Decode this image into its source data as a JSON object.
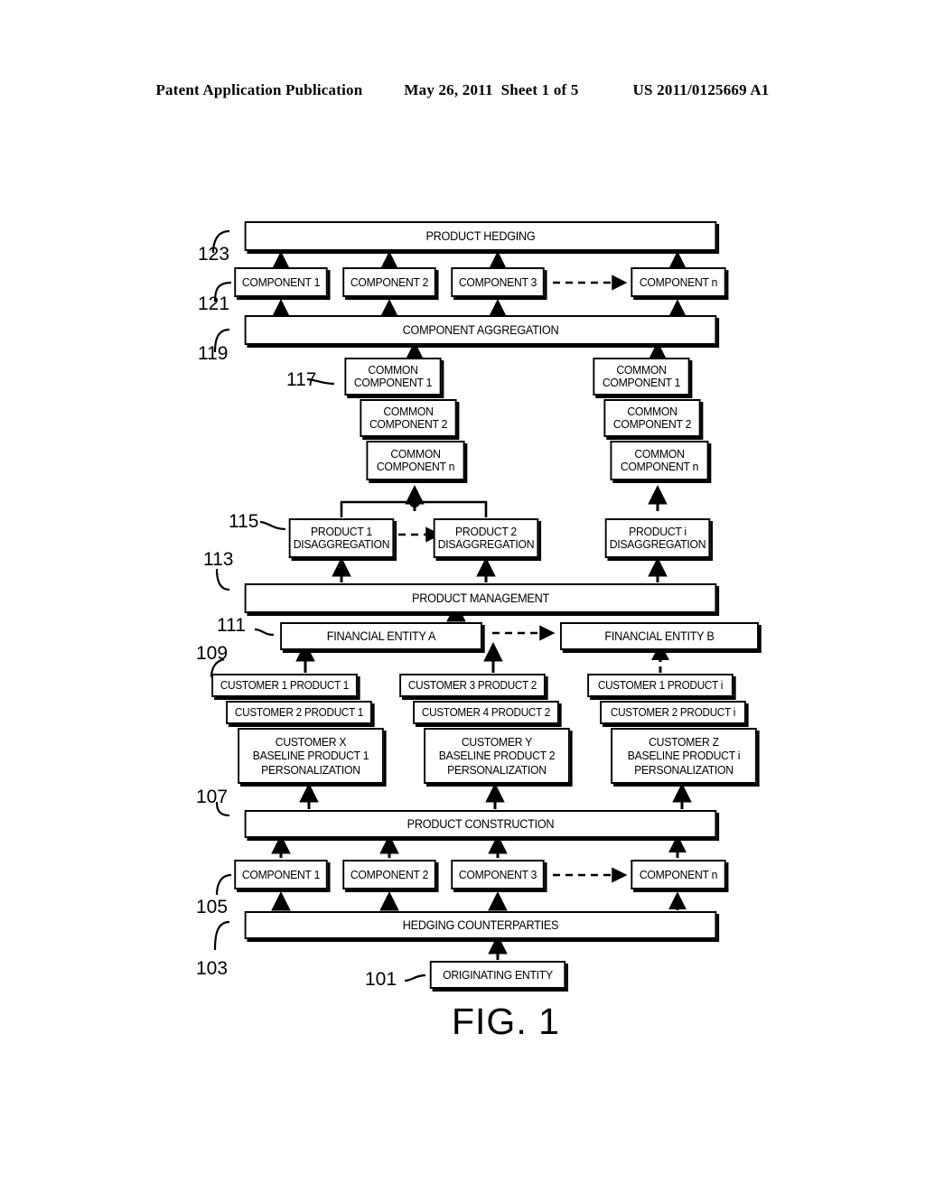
{
  "header": {
    "left": "Patent Application Publication",
    "date": "May 26, 2011",
    "sheet": "Sheet 1 of 5",
    "pubnum": "US 2011/0125669 A1"
  },
  "figure": {
    "label": "FIG. 1",
    "boxes": {
      "product_hedging": "PRODUCT HEDGING",
      "component_aggregation": "COMPONENT AGGREGATION",
      "product_management": "PRODUCT MANAGEMENT",
      "product_construction": "PRODUCT CONSTRUCTION",
      "hedging_counterparties": "HEDGING COUNTERPARTIES",
      "originating_entity": "ORIGINATING ENTITY",
      "financial_entity_a": "FINANCIAL ENTITY A",
      "financial_entity_b": "FINANCIAL ENTITY B"
    },
    "top_components": [
      "COMPONENT 1",
      "COMPONENT 2",
      "COMPONENT 3",
      "COMPONENT n"
    ],
    "bottom_components": [
      "COMPONENT 1",
      "COMPONENT 2",
      "COMPONENT 3",
      "COMPONENT n"
    ],
    "common_component_stack_left": [
      "COMMON\nCOMPONENT 1",
      "COMMON\nCOMPONENT 2",
      "COMMON\nCOMPONENT n"
    ],
    "common_component_stack_right": [
      "COMMON\nCOMPONENT 1",
      "COMMON\nCOMPONENT 2",
      "COMMON\nCOMPONENT n"
    ],
    "disaggregation": [
      "PRODUCT 1\nDISAGGREGATION",
      "PRODUCT 2\nDISAGGREGATION",
      "PRODUCT i\nDISAGGREGATION"
    ],
    "customer_group_1": [
      "CUSTOMER 1 PRODUCT 1",
      "CUSTOMER 2 PRODUCT 1",
      "CUSTOMER X\nBASELINE PRODUCT 1\nPERSONALIZATION"
    ],
    "customer_group_2": [
      "CUSTOMER 3 PRODUCT 2",
      "CUSTOMER 4 PRODUCT 2",
      "CUSTOMER Y\nBASELINE PRODUCT 2\nPERSONALIZATION"
    ],
    "customer_group_3": [
      "CUSTOMER 1 PRODUCT i",
      "CUSTOMER 2 PRODUCT i",
      "CUSTOMER Z\nBASELINE PRODUCT i\nPERSONALIZATION"
    ],
    "reference_numerals": {
      "n101": "101",
      "n103": "103",
      "n105": "105",
      "n107": "107",
      "n109": "109",
      "n111": "111",
      "n113": "113",
      "n115": "115",
      "n117": "117",
      "n119": "119",
      "n121": "121",
      "n123": "123"
    }
  }
}
